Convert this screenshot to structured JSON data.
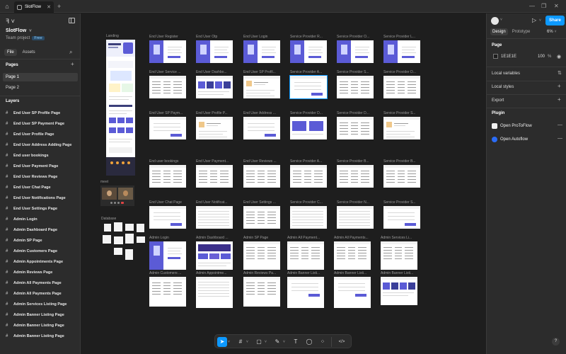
{
  "titlebar": {
    "home_icon": "home-icon",
    "tab_label": "SlotFlow",
    "close_glyph": "✕",
    "plus_glyph": "+",
    "win_controls": [
      "—",
      "❐",
      "✕"
    ]
  },
  "left": {
    "file_name": "SlotFlow",
    "team": "Team project",
    "plan_badge": "Free",
    "tabs": [
      "File",
      "Assets"
    ],
    "pages_title": "Pages",
    "pages": [
      "Page 1",
      "Page 2"
    ],
    "layers_title": "Layers",
    "layers": [
      "End User SP Profile Page",
      "End User SP Payment Page",
      "End User Profile Page",
      "End User Address Adding Page",
      "End user bookings",
      "End User Payment Page",
      "End User Reviews Page",
      "End User Chat Page",
      "End User Notifications Page",
      "End User Settings Page",
      "Admin Login",
      "Admin Dashboard Page",
      "Admin SP Page",
      "Admin Customers Page",
      "Admin Appointments Page",
      "Admin Reviews Page",
      "Admin All Payments Page",
      "Admin All Payments Page",
      "Admin Services Listing Page",
      "Admin Banner Listing Page",
      "Admin Banner Listing Page",
      "Admin Banner Listing Page"
    ]
  },
  "canvas": {
    "labels": {
      "landing": "Landing",
      "meet": "meet",
      "database": "Database"
    },
    "frames": [
      {
        "label": "End User Register",
        "style": "hero"
      },
      {
        "label": "End User Otp",
        "style": "hero"
      },
      {
        "label": "End User Login",
        "style": "hero"
      },
      {
        "label": "Service Provider R...",
        "style": "hero"
      },
      {
        "label": "Service Provider O...",
        "style": "hero"
      },
      {
        "label": "Service Provider L...",
        "style": "hero"
      },
      {
        "label": "End User Service ...",
        "style": "table"
      },
      {
        "label": "End User Dashbo...",
        "style": "cards"
      },
      {
        "label": "End User SP Profil...",
        "style": "profile"
      },
      {
        "label": "Service Provider A...",
        "style": "form"
      },
      {
        "label": "Service Provider S...",
        "style": "table"
      },
      {
        "label": "Service Provider D...",
        "style": "table"
      },
      {
        "label": "End User SP Paym...",
        "style": "form"
      },
      {
        "label": "End User Profile P...",
        "style": "profile"
      },
      {
        "label": "End User Address ...",
        "style": "form"
      },
      {
        "label": "Service Provider D...",
        "style": "banner"
      },
      {
        "label": "Service Provider D...",
        "style": "table"
      },
      {
        "label": "Service Provider S...",
        "style": "profile"
      },
      {
        "label": "End user bookings",
        "style": "table"
      },
      {
        "label": "End User Payment...",
        "style": "table"
      },
      {
        "label": "End User Reviews ...",
        "style": "table"
      },
      {
        "label": "Service Provider A...",
        "style": "table"
      },
      {
        "label": "Service Provider B...",
        "style": "table"
      },
      {
        "label": "Service Provider B...",
        "style": "table"
      },
      {
        "label": "End User Chat Page",
        "style": "form"
      },
      {
        "label": "End User Notificat...",
        "style": "list"
      },
      {
        "label": "End User Settings ...",
        "style": "table"
      },
      {
        "label": "Service Provider C...",
        "style": "list"
      },
      {
        "label": "Service Provider N...",
        "style": "list"
      },
      {
        "label": "Service Provider S...",
        "style": "form"
      },
      {
        "label": "Admin Login",
        "style": "hero"
      },
      {
        "label": "Admin Dashboard ...",
        "style": "dash"
      },
      {
        "label": "Admin SP Page",
        "style": "table"
      },
      {
        "label": "Admin All Payment...",
        "style": "table"
      },
      {
        "label": "Admin All Payments...",
        "style": "table"
      },
      {
        "label": "Admin Services Li...",
        "style": "table"
      },
      {
        "label": "Admin Customers ...",
        "style": "table"
      },
      {
        "label": "Admin Appointme...",
        "style": "list"
      },
      {
        "label": "Admin Reviews Pa...",
        "style": "table"
      },
      {
        "label": "Admin Banner Listi...",
        "style": "form"
      },
      {
        "label": "Admin Banner Listi...",
        "style": "form"
      },
      {
        "label": "Admin Banner Listi...",
        "style": "cards"
      }
    ]
  },
  "toolbar": {
    "tools": [
      {
        "name": "move-tool",
        "glyph": "➤",
        "active": true
      },
      {
        "name": "frame-tool",
        "glyph": "#",
        "active": false
      },
      {
        "name": "shape-tool",
        "glyph": "▢",
        "active": false
      },
      {
        "name": "pen-tool",
        "glyph": "✎",
        "active": false
      },
      {
        "name": "text-tool",
        "glyph": "T",
        "active": false
      },
      {
        "name": "comment-tool",
        "glyph": "◯",
        "active": false
      },
      {
        "name": "actions-tool",
        "glyph": "⁘",
        "active": false
      },
      {
        "name": "dev-mode-tool",
        "glyph": "</>",
        "active": false
      }
    ]
  },
  "right": {
    "share_label": "Share",
    "tabs": [
      "Design",
      "Prototype"
    ],
    "zoom": "6%",
    "page_title": "Page",
    "page_color": "1E1E1E",
    "page_opacity": "100",
    "pct_sign": "%",
    "local_variables": "Local variables",
    "local_styles": "Local styles",
    "export": "Export",
    "plugin_title": "Plugin",
    "plugins": [
      {
        "label": "Open ProToFlow",
        "color": "#f2f2f2"
      },
      {
        "label": "Open Autoflow",
        "color": "#2b6cf6"
      }
    ],
    "help": "?"
  }
}
